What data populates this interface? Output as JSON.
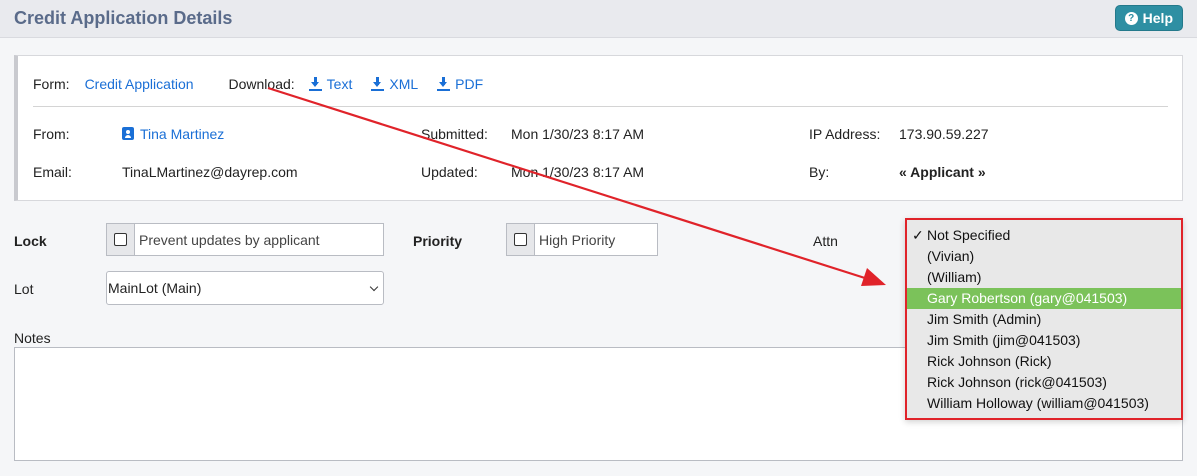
{
  "header": {
    "title": "Credit Application Details",
    "help_label": "Help"
  },
  "card": {
    "form_label": "Form:",
    "form_link": "Credit Application",
    "download_label": "Download:",
    "downloads": [
      "Text",
      "XML",
      "PDF"
    ],
    "from_label": "From:",
    "from_value": "Tina Martinez",
    "email_label": "Email:",
    "email_value": "TinaLMartinez@dayrep.com",
    "submitted_label": "Submitted:",
    "submitted_value": "Mon 1/30/23 8:17 AM",
    "updated_label": "Updated:",
    "updated_value": "Mon 1/30/23 8:17 AM",
    "ip_label": "IP Address:",
    "ip_value": "173.90.59.227",
    "by_label": "By:",
    "by_value": "« Applicant »"
  },
  "form": {
    "lock_label": "Lock",
    "lock_checkbox": "Prevent updates by applicant",
    "priority_label": "Priority",
    "priority_checkbox": "High Priority",
    "attn_label": "Attn",
    "lot_label": "Lot",
    "lot_value": "MainLot (Main)",
    "notes_label": "Notes"
  },
  "attn_dropdown": {
    "checked_mark": "✓",
    "options": [
      "Not Specified",
      "(Vivian)",
      "(William)",
      "Gary Robertson (gary@041503)",
      "Jim Smith (Admin)",
      "Jim Smith (jim@041503)",
      "Rick Johnson (Rick)",
      "Rick Johnson (rick@041503)",
      "William Holloway (william@041503)"
    ],
    "checked_index": 0,
    "highlighted_index": 3
  },
  "colors": {
    "accent": "#2e8fa3",
    "link": "#1a6fd6",
    "highlight": "#7bc25a",
    "annotation": "#e0232a"
  }
}
